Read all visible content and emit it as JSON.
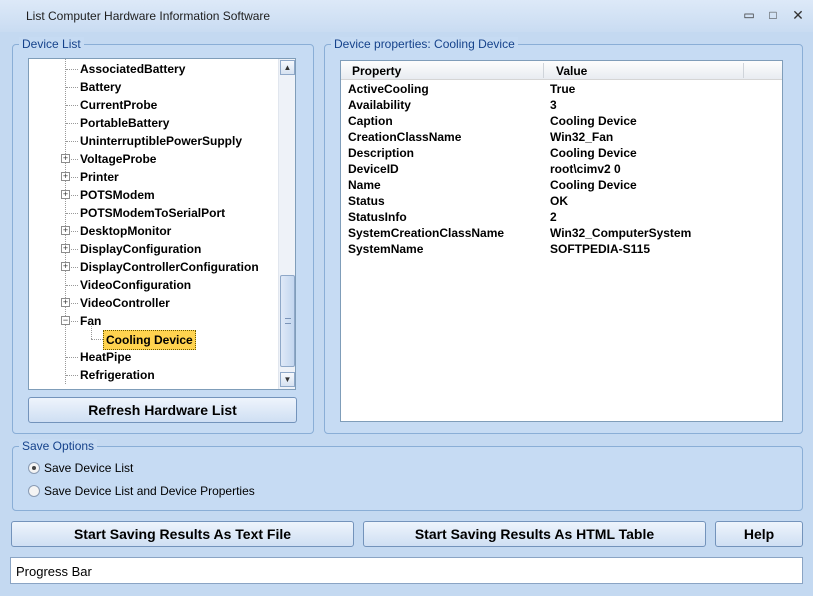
{
  "window": {
    "title": "List Computer Hardware Information Software",
    "minimize": "▭",
    "maximize": "□",
    "close": "✕"
  },
  "device_list": {
    "label": "Device List",
    "items": [
      {
        "label": "AssociatedBattery",
        "expander": ""
      },
      {
        "label": "Battery",
        "expander": ""
      },
      {
        "label": "CurrentProbe",
        "expander": ""
      },
      {
        "label": "PortableBattery",
        "expander": ""
      },
      {
        "label": "UninterruptiblePowerSupply",
        "expander": ""
      },
      {
        "label": "VoltageProbe",
        "expander": "+"
      },
      {
        "label": "Printer",
        "expander": "+"
      },
      {
        "label": "POTSModem",
        "expander": "+"
      },
      {
        "label": "POTSModemToSerialPort",
        "expander": ""
      },
      {
        "label": "DesktopMonitor",
        "expander": "+"
      },
      {
        "label": "DisplayConfiguration",
        "expander": "+"
      },
      {
        "label": "DisplayControllerConfiguration",
        "expander": "+"
      },
      {
        "label": "VideoConfiguration",
        "expander": ""
      },
      {
        "label": "VideoController",
        "expander": "+"
      },
      {
        "label": "Fan",
        "expander": "−"
      },
      {
        "label": "Cooling Device",
        "expander": "",
        "child": true,
        "selected": true
      },
      {
        "label": "HeatPipe",
        "expander": ""
      },
      {
        "label": "Refrigeration",
        "expander": ""
      }
    ],
    "refresh_button": "Refresh Hardware List"
  },
  "properties": {
    "label": "Device properties: Cooling Device",
    "columns": [
      "Property",
      "Value"
    ],
    "rows": [
      {
        "property": "ActiveCooling",
        "value": "True"
      },
      {
        "property": "Availability",
        "value": "3"
      },
      {
        "property": "Caption",
        "value": "Cooling Device"
      },
      {
        "property": "CreationClassName",
        "value": "Win32_Fan"
      },
      {
        "property": "Description",
        "value": "Cooling Device"
      },
      {
        "property": "DeviceID",
        "value": "root\\cimv2 0"
      },
      {
        "property": "Name",
        "value": "Cooling Device"
      },
      {
        "property": "Status",
        "value": "OK"
      },
      {
        "property": "StatusInfo",
        "value": "2"
      },
      {
        "property": "SystemCreationClassName",
        "value": "Win32_ComputerSystem"
      },
      {
        "property": "SystemName",
        "value": "SOFTPEDIA-S115"
      }
    ]
  },
  "save_options": {
    "label": "Save Options",
    "options": [
      {
        "label": "Save Device List",
        "selected": true
      },
      {
        "label": "Save Device List and Device Properties",
        "selected": false
      }
    ]
  },
  "buttons": {
    "save_text": "Start Saving Results As Text File",
    "save_html": "Start Saving Results As HTML Table",
    "help": "Help"
  },
  "progress": {
    "label": "Progress Bar"
  },
  "scrollbar": {
    "up": "▲",
    "down": "▼"
  }
}
